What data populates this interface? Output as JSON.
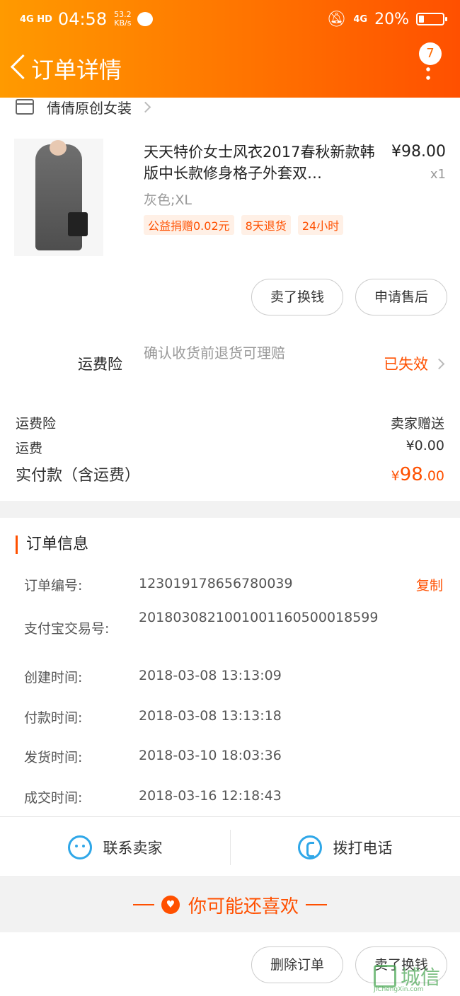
{
  "status_bar": {
    "network": "4G HD",
    "time": "04:58",
    "speed_value": "53.2",
    "speed_unit": "KB/s",
    "network_right": "4G",
    "battery": "20%"
  },
  "header": {
    "title": "订单详情",
    "badge_count": "7"
  },
  "shop": {
    "name": "倩倩原创女装"
  },
  "product": {
    "name": "天天特价女士风衣2017春秋新款韩版中长款修身格子外套双…",
    "price": "¥98.00",
    "quantity": "x1",
    "sku": "灰色;XL",
    "tags": [
      "公益捐赠0.02元",
      "8天退货",
      "24小时"
    ]
  },
  "item_buttons": {
    "sell": "卖了换钱",
    "after_sale": "申请售后"
  },
  "shipping_insurance": {
    "label": "运费险",
    "description": "确认收货前退货可理赔",
    "status": "已失效"
  },
  "summary": {
    "insurance_label": "运费险",
    "insurance_value": "卖家赠送",
    "shipping_label": "运费",
    "shipping_value": "¥0.00",
    "total_label": "实付款（含运费）",
    "total_currency": "¥",
    "total_int": "98",
    "total_dec": ".00"
  },
  "order_info": {
    "title": "订单信息",
    "copy_label": "复制",
    "rows": [
      {
        "key": "订单编号:",
        "value": "123019178656780039"
      },
      {
        "key": "支付宝交易号:",
        "value": "2018030821001001160500018599"
      },
      {
        "key": "创建时间:",
        "value": "2018-03-08 13:13:09"
      },
      {
        "key": "付款时间:",
        "value": "2018-03-08 13:13:18"
      },
      {
        "key": "发货时间:",
        "value": "2018-03-10 18:03:36"
      },
      {
        "key": "成交时间:",
        "value": "2018-03-16 12:18:43"
      }
    ]
  },
  "contact": {
    "seller": "联系卖家",
    "call": "拨打电话"
  },
  "recommend": {
    "title": "你可能还喜欢"
  },
  "bottom_buttons": {
    "delete": "删除订单",
    "sell": "卖了换钱"
  },
  "watermark": {
    "text": "城信",
    "site": "JiChengXin.com"
  },
  "colors": {
    "accent": "#ff5000",
    "header_start": "#ff9a00",
    "icon_blue": "#2fa7e8"
  }
}
